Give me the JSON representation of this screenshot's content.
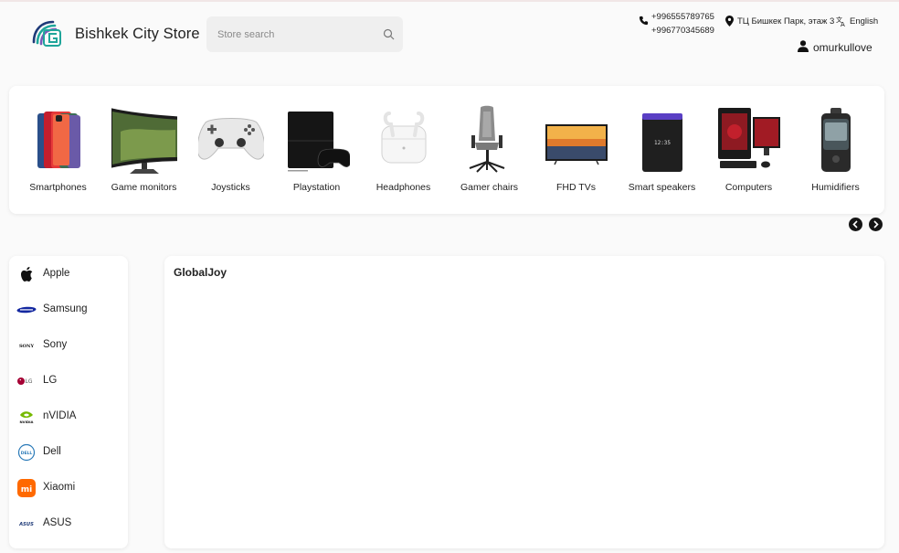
{
  "header": {
    "store_name": "Bishkek City Store",
    "search_placeholder": "Store search",
    "phones": [
      "+996555789765",
      "+996770345689"
    ],
    "address": "ТЦ Бишкек Парк, этаж 3",
    "language": "English",
    "username": "omurkullove"
  },
  "categories": [
    {
      "label": "Smartphones",
      "icon": "smartphones-image"
    },
    {
      "label": "Game monitors",
      "icon": "game-monitor-image"
    },
    {
      "label": "Joysticks",
      "icon": "joystick-image"
    },
    {
      "label": "Playstation",
      "icon": "playstation-image"
    },
    {
      "label": "Headphones",
      "icon": "headphones-image"
    },
    {
      "label": "Gamer chairs",
      "icon": "gamer-chair-image"
    },
    {
      "label": "FHD TVs",
      "icon": "tv-image"
    },
    {
      "label": "Smart speakers",
      "icon": "smart-speaker-image"
    },
    {
      "label": "Computers",
      "icon": "computer-image"
    },
    {
      "label": "Humidifiers",
      "icon": "humidifier-image"
    }
  ],
  "brands": [
    {
      "label": "Apple",
      "icon": "apple-icon"
    },
    {
      "label": "Samsung",
      "icon": "samsung-icon"
    },
    {
      "label": "Sony",
      "icon": "sony-icon"
    },
    {
      "label": "LG",
      "icon": "lg-icon"
    },
    {
      "label": "nVIDIA",
      "icon": "nvidia-icon"
    },
    {
      "label": "Dell",
      "icon": "dell-icon"
    },
    {
      "label": "Xiaomi",
      "icon": "xiaomi-icon"
    },
    {
      "label": "ASUS",
      "icon": "asus-icon"
    }
  ],
  "main": {
    "title": "GlobalJoy"
  },
  "colors": {
    "background": "#fafafa",
    "card": "#ffffff",
    "search_bg": "#efefef",
    "logo_teal": "#1fa59a",
    "logo_navy": "#1e3a78",
    "nav_button": "#161616",
    "nvidia_green": "#76b900",
    "xiaomi_orange": "#ff6900",
    "samsung_blue": "#1428a0",
    "lg_red": "#a50034"
  }
}
